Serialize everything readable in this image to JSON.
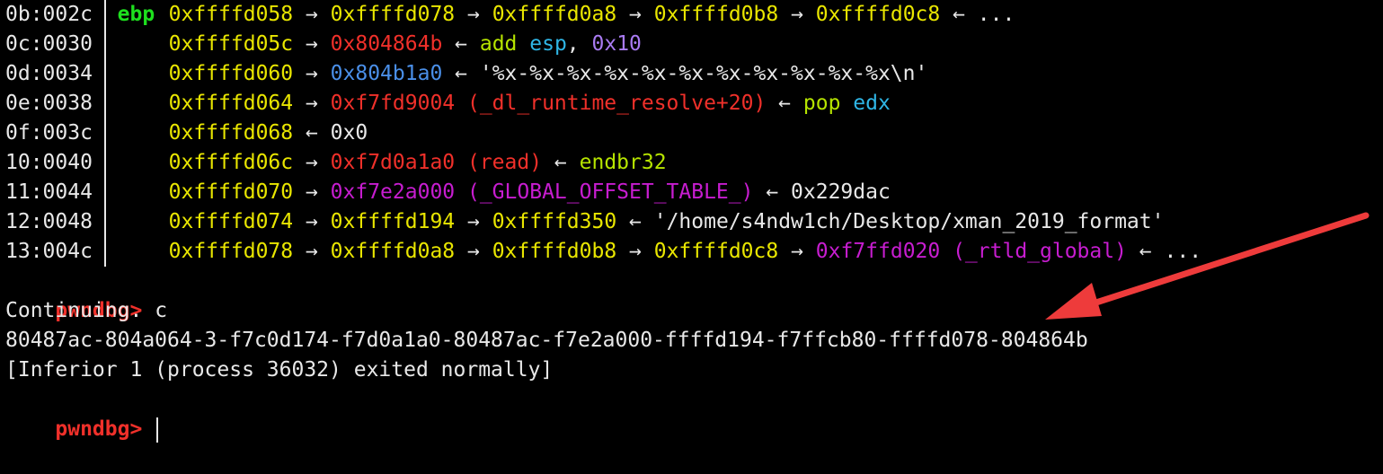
{
  "colors": {
    "background": "#000000",
    "text": "#e8e8e8",
    "address": "#e9e600",
    "code_pointer": "#f0302a",
    "data_pointer": "#4a8fe8",
    "instruction": "#b6e400",
    "register": "#1ee01e",
    "rwx_pointer": "#c71dd0",
    "immediate": "#a97bf2",
    "annotation_arrow": "#ee3b3b"
  },
  "stack": {
    "rows": [
      {
        "idx": "0b:002c",
        "reg": "ebp",
        "tokens": [
          {
            "t": "0xffffd058",
            "c": "yellow"
          },
          {
            "t": " → ",
            "c": "white"
          },
          {
            "t": "0xffffd078",
            "c": "yellow"
          },
          {
            "t": " → ",
            "c": "white"
          },
          {
            "t": "0xffffd0a8",
            "c": "yellow"
          },
          {
            "t": " → ",
            "c": "white"
          },
          {
            "t": "0xffffd0b8",
            "c": "yellow"
          },
          {
            "t": " → ",
            "c": "white"
          },
          {
            "t": "0xffffd0c8",
            "c": "yellow"
          },
          {
            "t": " ← ...",
            "c": "white"
          }
        ]
      },
      {
        "idx": "0c:0030",
        "reg": "",
        "tokens": [
          {
            "t": "0xffffd05c",
            "c": "yellow"
          },
          {
            "t": " → ",
            "c": "white"
          },
          {
            "t": "0x804864b",
            "c": "red"
          },
          {
            "t": " ← ",
            "c": "white"
          },
          {
            "t": "add",
            "c": "green"
          },
          {
            "t": " ",
            "c": "white"
          },
          {
            "t": "esp",
            "c": "cyan"
          },
          {
            "t": ", ",
            "c": "white"
          },
          {
            "t": "0x10",
            "c": "purple"
          }
        ]
      },
      {
        "idx": "0d:0034",
        "reg": "",
        "tokens": [
          {
            "t": "0xffffd060",
            "c": "yellow"
          },
          {
            "t": " → ",
            "c": "white"
          },
          {
            "t": "0x804b1a0",
            "c": "blue"
          },
          {
            "t": " ← ",
            "c": "white"
          },
          {
            "t": "'%x-%x-%x-%x-%x-%x-%x-%x-%x-%x-%x\\n'",
            "c": "white"
          }
        ]
      },
      {
        "idx": "0e:0038",
        "reg": "",
        "tokens": [
          {
            "t": "0xffffd064",
            "c": "yellow"
          },
          {
            "t": " → ",
            "c": "white"
          },
          {
            "t": "0xf7fd9004 (_dl_runtime_resolve+20)",
            "c": "red"
          },
          {
            "t": " ← ",
            "c": "white"
          },
          {
            "t": "pop",
            "c": "green"
          },
          {
            "t": " ",
            "c": "white"
          },
          {
            "t": "edx",
            "c": "cyan"
          }
        ]
      },
      {
        "idx": "0f:003c",
        "reg": "",
        "tokens": [
          {
            "t": "0xffffd068",
            "c": "yellow"
          },
          {
            "t": " ← ",
            "c": "white"
          },
          {
            "t": "0x0",
            "c": "white"
          }
        ]
      },
      {
        "idx": "10:0040",
        "reg": "",
        "tokens": [
          {
            "t": "0xffffd06c",
            "c": "yellow"
          },
          {
            "t": " → ",
            "c": "white"
          },
          {
            "t": "0xf7d0a1a0 (read)",
            "c": "red"
          },
          {
            "t": " ← ",
            "c": "white"
          },
          {
            "t": "endbr32",
            "c": "green"
          }
        ]
      },
      {
        "idx": "11:0044",
        "reg": "",
        "tokens": [
          {
            "t": "0xffffd070",
            "c": "yellow"
          },
          {
            "t": " → ",
            "c": "white"
          },
          {
            "t": "0xf7e2a000 (_GLOBAL_OFFSET_TABLE_)",
            "c": "magenta"
          },
          {
            "t": " ← ",
            "c": "white"
          },
          {
            "t": "0x229dac",
            "c": "white"
          }
        ]
      },
      {
        "idx": "12:0048",
        "reg": "",
        "tokens": [
          {
            "t": "0xffffd074",
            "c": "yellow"
          },
          {
            "t": " → ",
            "c": "white"
          },
          {
            "t": "0xffffd194",
            "c": "yellow"
          },
          {
            "t": " → ",
            "c": "white"
          },
          {
            "t": "0xffffd350",
            "c": "yellow"
          },
          {
            "t": " ← ",
            "c": "white"
          },
          {
            "t": "'/home/s4ndw1ch/Desktop/xman_2019_format'",
            "c": "white"
          }
        ]
      },
      {
        "idx": "13:004c",
        "reg": "",
        "tokens": [
          {
            "t": "0xffffd078",
            "c": "yellow"
          },
          {
            "t": " → ",
            "c": "white"
          },
          {
            "t": "0xffffd0a8",
            "c": "yellow"
          },
          {
            "t": " → ",
            "c": "white"
          },
          {
            "t": "0xffffd0b8",
            "c": "yellow"
          },
          {
            "t": " → ",
            "c": "white"
          },
          {
            "t": "0xffffd0c8",
            "c": "yellow"
          },
          {
            "t": " → ",
            "c": "white"
          },
          {
            "t": "0xf7ffd020 (_rtld_global)",
            "c": "magenta"
          },
          {
            "t": " ← ...",
            "c": "white"
          }
        ]
      }
    ]
  },
  "session": {
    "prompt": "pwndbg>",
    "command": "c",
    "continuing": "Continuing.",
    "leak_output": "80487ac-804a064-3-f7c0d174-f7d0a1a0-80487ac-f7e2a000-ffffd194-f7ffcb80-ffffd078-804864b",
    "exit_message": "[Inferior 1 (process 36032) exited normally]",
    "final_prompt": "pwndbg>"
  }
}
